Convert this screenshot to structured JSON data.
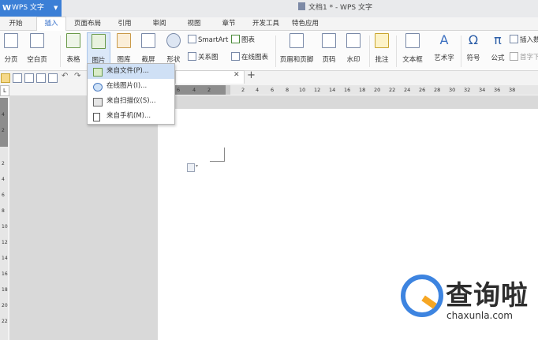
{
  "app": {
    "name": "WPS 文字",
    "doc_title": "文档1 * - WPS 文字"
  },
  "tabs": [
    {
      "label": "开始"
    },
    {
      "label": "插入"
    },
    {
      "label": "页面布局"
    },
    {
      "label": "引用"
    },
    {
      "label": "审阅"
    },
    {
      "label": "视图"
    },
    {
      "label": "章节"
    },
    {
      "label": "开发工具"
    },
    {
      "label": "特色应用"
    }
  ],
  "active_tab": "插入",
  "ribbon": {
    "page_break": "分页",
    "blank_page": "空白页",
    "table": "表格",
    "picture": "图片",
    "gallery": "图库",
    "screenshot": "截屏",
    "shapes": "形状",
    "smartart": "SmartArt",
    "chart": "图表",
    "relation": "关系图",
    "online_chart": "在线图表",
    "header_footer": "页眉和页脚",
    "page_number": "页码",
    "watermark": "水印",
    "comment": "批注",
    "textbox": "文本框",
    "wordart": "艺术字",
    "symbol": "符号",
    "formula": "公式",
    "insert_number": "插入数",
    "drop_cap": "首字下"
  },
  "picture_menu": [
    {
      "label": "来自文件(P)..."
    },
    {
      "label": "在线图片(I)..."
    },
    {
      "label": "来自扫描仪(S)..."
    },
    {
      "label": "来自手机(M)..."
    }
  ],
  "ruler": {
    "numbers": [
      "6",
      "4",
      "2",
      "2",
      "4",
      "6",
      "8",
      "10",
      "12",
      "14",
      "16",
      "18",
      "20",
      "22",
      "24",
      "26",
      "28",
      "30",
      "32",
      "34",
      "36",
      "38"
    ]
  },
  "vruler": {
    "numbers": [
      "4",
      "2",
      "2",
      "4",
      "6",
      "8",
      "10",
      "12",
      "14",
      "16",
      "18",
      "20",
      "22"
    ]
  },
  "watermark": {
    "brand_cn": "查询啦",
    "url": "chaxunla.com"
  },
  "colors": {
    "accent": "#3b7fd6",
    "brand_orange": "#f6a623"
  }
}
